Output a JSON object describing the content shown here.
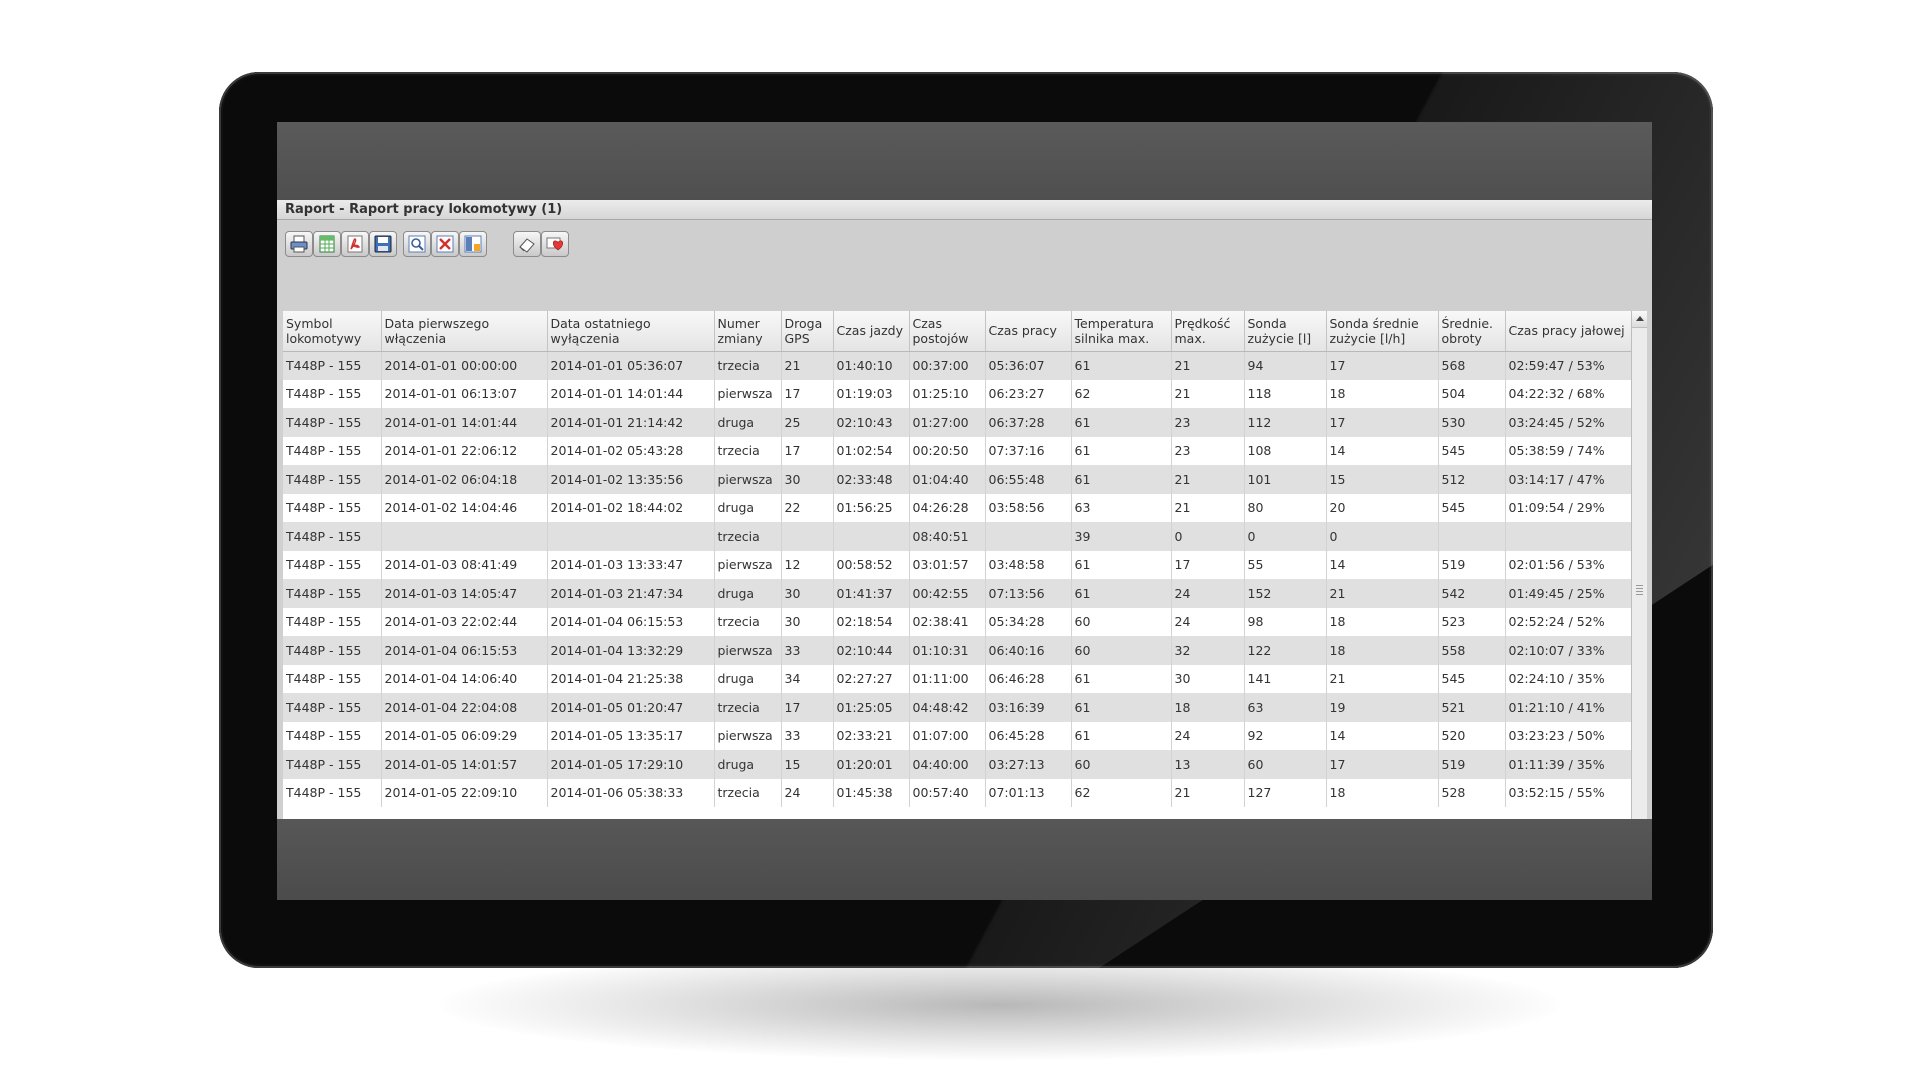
{
  "window": {
    "title": "Raport - Raport pracy lokomotywy (1)"
  },
  "toolbar": {
    "buttons": [
      {
        "name": "print-button",
        "icon": "printer-icon"
      },
      {
        "name": "export-excel-button",
        "icon": "excel-icon"
      },
      {
        "name": "export-pdf-button",
        "icon": "pdf-icon"
      },
      {
        "name": "save-button",
        "icon": "floppy-disk-icon"
      },
      {
        "name": "preview-button",
        "icon": "magnifier-icon"
      },
      {
        "name": "close-report-button",
        "icon": "close-x-icon"
      },
      {
        "name": "layout-button",
        "icon": "columns-icon"
      },
      {
        "name": "eraser-button",
        "icon": "eraser-icon"
      },
      {
        "name": "favorite-button",
        "icon": "heart-icon"
      }
    ]
  },
  "table": {
    "columns": [
      "Symbol lokomotywy",
      "Data pierwszego włączenia",
      "Data ostatniego wyłączenia",
      "Numer zmiany",
      "Droga GPS",
      "Czas jazdy",
      "Czas postojów",
      "Czas pracy",
      "Temperatura silnika max.",
      "Prędkość max.",
      "Sonda zużycie [l]",
      "Sonda średnie zużycie [l/h]",
      "Średnie. obroty",
      "Czas pracy jałowej"
    ],
    "rows": [
      [
        "T448P - 155",
        "2014-01-01 00:00:00",
        "2014-01-01 05:36:07",
        "trzecia",
        "21",
        "01:40:10",
        "00:37:00",
        "05:36:07",
        "61",
        "21",
        "94",
        "17",
        "568",
        "02:59:47 / 53%"
      ],
      [
        "T448P - 155",
        "2014-01-01 06:13:07",
        "2014-01-01 14:01:44",
        "pierwsza",
        "17",
        "01:19:03",
        "01:25:10",
        "06:23:27",
        "62",
        "21",
        "118",
        "18",
        "504",
        "04:22:32 / 68%"
      ],
      [
        "T448P - 155",
        "2014-01-01 14:01:44",
        "2014-01-01 21:14:42",
        "druga",
        "25",
        "02:10:43",
        "01:27:00",
        "06:37:28",
        "61",
        "23",
        "112",
        "17",
        "530",
        "03:24:45 / 52%"
      ],
      [
        "T448P - 155",
        "2014-01-01 22:06:12",
        "2014-01-02 05:43:28",
        "trzecia",
        "17",
        "01:02:54",
        "00:20:50",
        "07:37:16",
        "61",
        "23",
        "108",
        "14",
        "545",
        "05:38:59 / 74%"
      ],
      [
        "T448P - 155",
        "2014-01-02 06:04:18",
        "2014-01-02 13:35:56",
        "pierwsza",
        "30",
        "02:33:48",
        "01:04:40",
        "06:55:48",
        "61",
        "21",
        "101",
        "15",
        "512",
        "03:14:17 / 47%"
      ],
      [
        "T448P - 155",
        "2014-01-02 14:04:46",
        "2014-01-02 18:44:02",
        "druga",
        "22",
        "01:56:25",
        "04:26:28",
        "03:58:56",
        "63",
        "21",
        "80",
        "20",
        "545",
        "01:09:54 / 29%"
      ],
      [
        "T448P - 155",
        "",
        "",
        "trzecia",
        "",
        "",
        "08:40:51",
        "",
        "39",
        "0",
        "0",
        "0",
        "",
        ""
      ],
      [
        "T448P - 155",
        "2014-01-03 08:41:49",
        "2014-01-03 13:33:47",
        "pierwsza",
        "12",
        "00:58:52",
        "03:01:57",
        "03:48:58",
        "61",
        "17",
        "55",
        "14",
        "519",
        "02:01:56 / 53%"
      ],
      [
        "T448P - 155",
        "2014-01-03 14:05:47",
        "2014-01-03 21:47:34",
        "druga",
        "30",
        "01:41:37",
        "00:42:55",
        "07:13:56",
        "61",
        "24",
        "152",
        "21",
        "542",
        "01:49:45 / 25%"
      ],
      [
        "T448P - 155",
        "2014-01-03 22:02:44",
        "2014-01-04 06:15:53",
        "trzecia",
        "30",
        "02:18:54",
        "02:38:41",
        "05:34:28",
        "60",
        "24",
        "98",
        "18",
        "523",
        "02:52:24 / 52%"
      ],
      [
        "T448P - 155",
        "2014-01-04 06:15:53",
        "2014-01-04 13:32:29",
        "pierwsza",
        "33",
        "02:10:44",
        "01:10:31",
        "06:40:16",
        "60",
        "32",
        "122",
        "18",
        "558",
        "02:10:07 / 33%"
      ],
      [
        "T448P - 155",
        "2014-01-04 14:06:40",
        "2014-01-04 21:25:38",
        "druga",
        "34",
        "02:27:27",
        "01:11:00",
        "06:46:28",
        "61",
        "30",
        "141",
        "21",
        "545",
        "02:24:10 / 35%"
      ],
      [
        "T448P - 155",
        "2014-01-04 22:04:08",
        "2014-01-05 01:20:47",
        "trzecia",
        "17",
        "01:25:05",
        "04:48:42",
        "03:16:39",
        "61",
        "18",
        "63",
        "19",
        "521",
        "01:21:10 / 41%"
      ],
      [
        "T448P - 155",
        "2014-01-05 06:09:29",
        "2014-01-05 13:35:17",
        "pierwsza",
        "33",
        "02:33:21",
        "01:07:00",
        "06:45:28",
        "61",
        "24",
        "92",
        "14",
        "520",
        "03:23:23 / 50%"
      ],
      [
        "T448P - 155",
        "2014-01-05 14:01:57",
        "2014-01-05 17:29:10",
        "druga",
        "15",
        "01:20:01",
        "04:40:00",
        "03:27:13",
        "60",
        "13",
        "60",
        "17",
        "519",
        "01:11:39 / 35%"
      ],
      [
        "T448P - 155",
        "2014-01-05 22:09:10",
        "2014-01-06 05:38:33",
        "trzecia",
        "24",
        "01:45:38",
        "00:57:40",
        "07:01:13",
        "62",
        "21",
        "127",
        "18",
        "528",
        "03:52:15 / 55%"
      ]
    ]
  }
}
